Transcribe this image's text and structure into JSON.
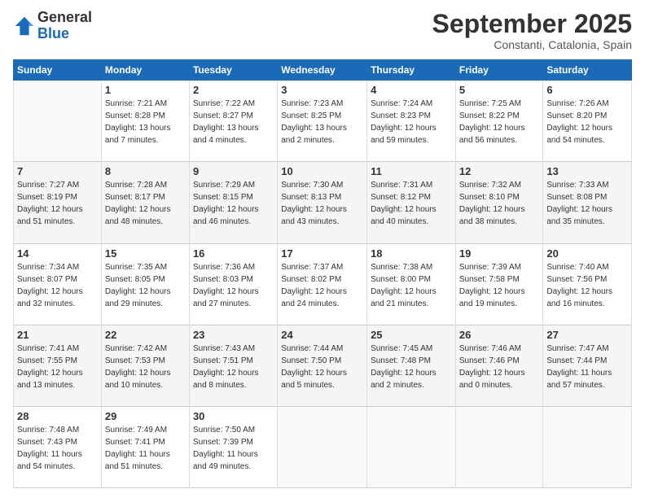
{
  "header": {
    "logo_line1": "General",
    "logo_line2": "Blue",
    "month": "September 2025",
    "location": "Constanti, Catalonia, Spain"
  },
  "days_of_week": [
    "Sunday",
    "Monday",
    "Tuesday",
    "Wednesday",
    "Thursday",
    "Friday",
    "Saturday"
  ],
  "weeks": [
    [
      {
        "day": "",
        "info": ""
      },
      {
        "day": "1",
        "info": "Sunrise: 7:21 AM\nSunset: 8:28 PM\nDaylight: 13 hours\nand 7 minutes."
      },
      {
        "day": "2",
        "info": "Sunrise: 7:22 AM\nSunset: 8:27 PM\nDaylight: 13 hours\nand 4 minutes."
      },
      {
        "day": "3",
        "info": "Sunrise: 7:23 AM\nSunset: 8:25 PM\nDaylight: 13 hours\nand 2 minutes."
      },
      {
        "day": "4",
        "info": "Sunrise: 7:24 AM\nSunset: 8:23 PM\nDaylight: 12 hours\nand 59 minutes."
      },
      {
        "day": "5",
        "info": "Sunrise: 7:25 AM\nSunset: 8:22 PM\nDaylight: 12 hours\nand 56 minutes."
      },
      {
        "day": "6",
        "info": "Sunrise: 7:26 AM\nSunset: 8:20 PM\nDaylight: 12 hours\nand 54 minutes."
      }
    ],
    [
      {
        "day": "7",
        "info": "Sunrise: 7:27 AM\nSunset: 8:19 PM\nDaylight: 12 hours\nand 51 minutes."
      },
      {
        "day": "8",
        "info": "Sunrise: 7:28 AM\nSunset: 8:17 PM\nDaylight: 12 hours\nand 48 minutes."
      },
      {
        "day": "9",
        "info": "Sunrise: 7:29 AM\nSunset: 8:15 PM\nDaylight: 12 hours\nand 46 minutes."
      },
      {
        "day": "10",
        "info": "Sunrise: 7:30 AM\nSunset: 8:13 PM\nDaylight: 12 hours\nand 43 minutes."
      },
      {
        "day": "11",
        "info": "Sunrise: 7:31 AM\nSunset: 8:12 PM\nDaylight: 12 hours\nand 40 minutes."
      },
      {
        "day": "12",
        "info": "Sunrise: 7:32 AM\nSunset: 8:10 PM\nDaylight: 12 hours\nand 38 minutes."
      },
      {
        "day": "13",
        "info": "Sunrise: 7:33 AM\nSunset: 8:08 PM\nDaylight: 12 hours\nand 35 minutes."
      }
    ],
    [
      {
        "day": "14",
        "info": "Sunrise: 7:34 AM\nSunset: 8:07 PM\nDaylight: 12 hours\nand 32 minutes."
      },
      {
        "day": "15",
        "info": "Sunrise: 7:35 AM\nSunset: 8:05 PM\nDaylight: 12 hours\nand 29 minutes."
      },
      {
        "day": "16",
        "info": "Sunrise: 7:36 AM\nSunset: 8:03 PM\nDaylight: 12 hours\nand 27 minutes."
      },
      {
        "day": "17",
        "info": "Sunrise: 7:37 AM\nSunset: 8:02 PM\nDaylight: 12 hours\nand 24 minutes."
      },
      {
        "day": "18",
        "info": "Sunrise: 7:38 AM\nSunset: 8:00 PM\nDaylight: 12 hours\nand 21 minutes."
      },
      {
        "day": "19",
        "info": "Sunrise: 7:39 AM\nSunset: 7:58 PM\nDaylight: 12 hours\nand 19 minutes."
      },
      {
        "day": "20",
        "info": "Sunrise: 7:40 AM\nSunset: 7:56 PM\nDaylight: 12 hours\nand 16 minutes."
      }
    ],
    [
      {
        "day": "21",
        "info": "Sunrise: 7:41 AM\nSunset: 7:55 PM\nDaylight: 12 hours\nand 13 minutes."
      },
      {
        "day": "22",
        "info": "Sunrise: 7:42 AM\nSunset: 7:53 PM\nDaylight: 12 hours\nand 10 minutes."
      },
      {
        "day": "23",
        "info": "Sunrise: 7:43 AM\nSunset: 7:51 PM\nDaylight: 12 hours\nand 8 minutes."
      },
      {
        "day": "24",
        "info": "Sunrise: 7:44 AM\nSunset: 7:50 PM\nDaylight: 12 hours\nand 5 minutes."
      },
      {
        "day": "25",
        "info": "Sunrise: 7:45 AM\nSunset: 7:48 PM\nDaylight: 12 hours\nand 2 minutes."
      },
      {
        "day": "26",
        "info": "Sunrise: 7:46 AM\nSunset: 7:46 PM\nDaylight: 12 hours\nand 0 minutes."
      },
      {
        "day": "27",
        "info": "Sunrise: 7:47 AM\nSunset: 7:44 PM\nDaylight: 11 hours\nand 57 minutes."
      }
    ],
    [
      {
        "day": "28",
        "info": "Sunrise: 7:48 AM\nSunset: 7:43 PM\nDaylight: 11 hours\nand 54 minutes."
      },
      {
        "day": "29",
        "info": "Sunrise: 7:49 AM\nSunset: 7:41 PM\nDaylight: 11 hours\nand 51 minutes."
      },
      {
        "day": "30",
        "info": "Sunrise: 7:50 AM\nSunset: 7:39 PM\nDaylight: 11 hours\nand 49 minutes."
      },
      {
        "day": "",
        "info": ""
      },
      {
        "day": "",
        "info": ""
      },
      {
        "day": "",
        "info": ""
      },
      {
        "day": "",
        "info": ""
      }
    ]
  ]
}
